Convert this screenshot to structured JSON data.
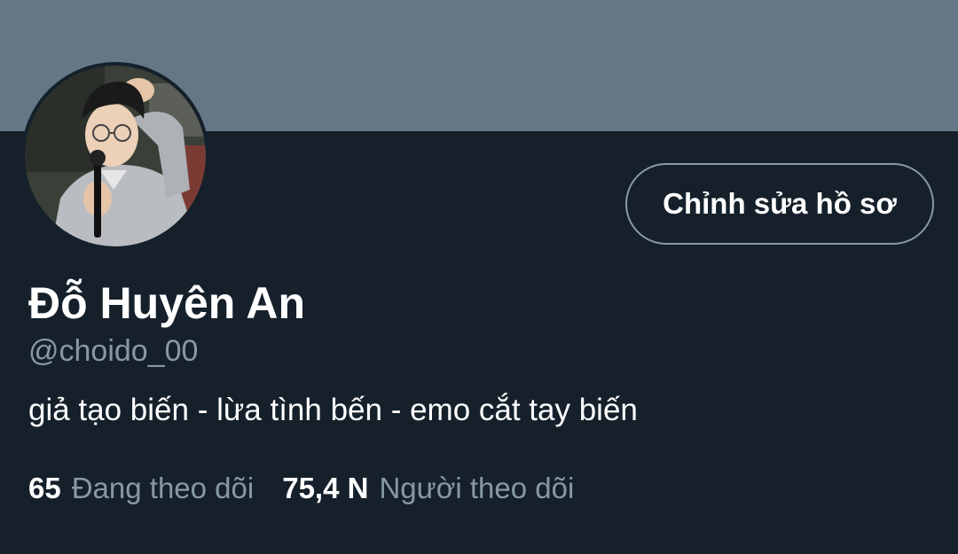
{
  "profile": {
    "display_name": "Đỗ Huyên An",
    "handle": "@choido_00",
    "bio": "giả tạo biến - lừa tình bến - emo cắt tay biến",
    "edit_button_label": "Chỉnh sửa hồ sơ",
    "following_count": "65",
    "following_label": "Đang theo dõi",
    "followers_count": "75,4 N",
    "followers_label": "Người theo dõi"
  },
  "colors": {
    "banner": "#657786",
    "background": "#15202b",
    "primary_text": "#ffffff",
    "secondary_text": "#8899a6"
  },
  "icons": {
    "avatar": "profile-photo"
  }
}
